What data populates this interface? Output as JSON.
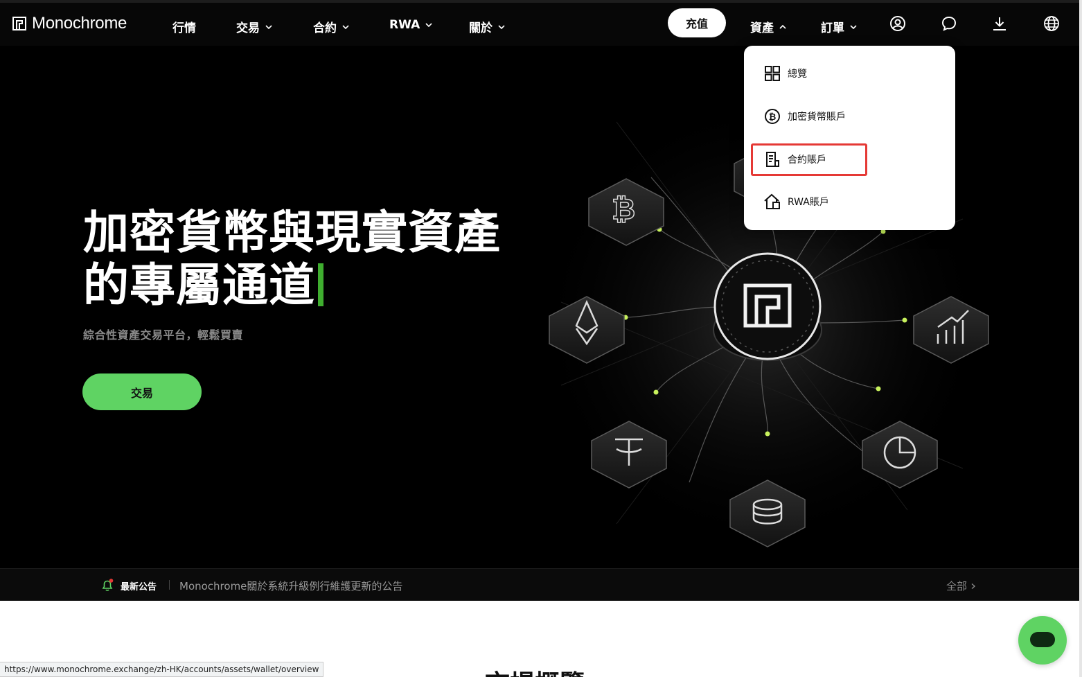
{
  "header": {
    "logo_text": "Monochrome",
    "nav": [
      {
        "label": "行情",
        "has_dropdown": false
      },
      {
        "label": "交易",
        "has_dropdown": true
      },
      {
        "label": "合約",
        "has_dropdown": true
      },
      {
        "label": "RWA",
        "has_dropdown": true
      },
      {
        "label": "關於",
        "has_dropdown": true
      }
    ],
    "deposit_label": "充值",
    "assets_label": "資產",
    "orders_label": "訂單",
    "icons": [
      "user-circle-icon",
      "chat-bubble-icon",
      "download-icon",
      "globe-icon"
    ]
  },
  "assets_menu": {
    "items": [
      {
        "label": "總覽",
        "icon": "grid-icon"
      },
      {
        "label": "加密貨幣賬戶",
        "icon": "bitcoin-icon"
      },
      {
        "label": "合約賬戶",
        "icon": "document-icon",
        "highlighted": true
      },
      {
        "label": "RWA賬戶",
        "icon": "house-icon"
      }
    ]
  },
  "hero": {
    "title_line1": "加密貨幣與現實資產",
    "title_line2": "的專屬通道",
    "subtitle": "綜合性資產交易平台，輕鬆買賣",
    "cta_label": "交易"
  },
  "announcement": {
    "label": "最新公告",
    "text": "Monochrome關於系統升級例行維護更新的公告",
    "all_label": "全部"
  },
  "section_title": "市場概覽",
  "status_url": "https://www.monochrome.exchange/zh-HK/accounts/assets/wallet/overview",
  "colors": {
    "accent_green": "#5fd363",
    "caret_green": "#3fae2f",
    "highlight_red": "#e53935",
    "header_bg": "#070707"
  }
}
